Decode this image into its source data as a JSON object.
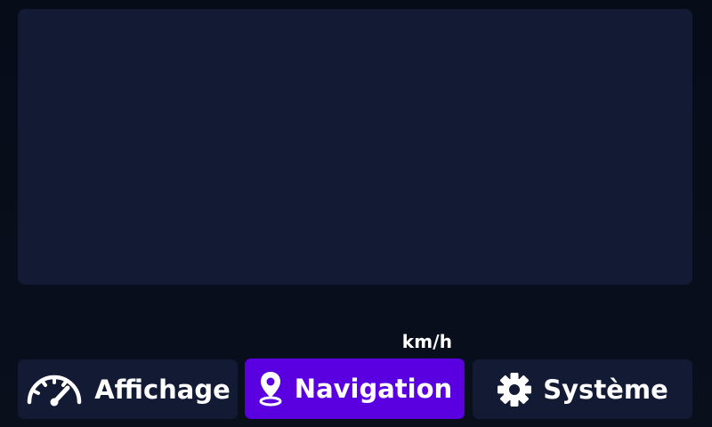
{
  "speed": {
    "unit": "km/h"
  },
  "tabs": [
    {
      "label": "Affichage",
      "icon": "speedometer-icon",
      "active": false
    },
    {
      "label": "Navigation",
      "icon": "map-pin-icon",
      "active": true
    },
    {
      "label": "Système",
      "icon": "gear-icon",
      "active": false
    }
  ],
  "colors": {
    "background": "#080d1a",
    "panel": "#131b34",
    "accent": "#5a00e0",
    "text": "#ffffff"
  }
}
